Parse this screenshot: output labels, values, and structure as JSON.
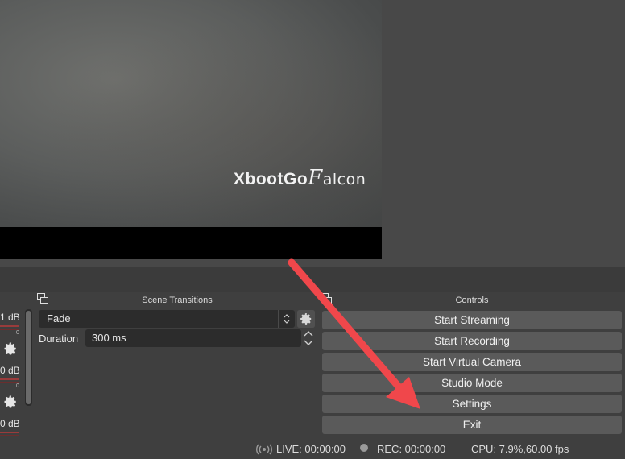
{
  "preview": {
    "watermark_part1": "Xboot",
    "watermark_part2": "Go",
    "watermark_part3": "F",
    "watermark_part4": "alcon"
  },
  "audio_mixer": {
    "channels": [
      {
        "db": "1 dB",
        "scale_zero": "0"
      },
      {
        "db": "0 dB",
        "scale_zero": "0"
      },
      {
        "db": "0 dB",
        "scale_zero": ""
      }
    ]
  },
  "scene_transitions": {
    "title": "Scene Transitions",
    "selected_transition": "Fade",
    "duration_label": "Duration",
    "duration_value": "300 ms"
  },
  "controls": {
    "title": "Controls",
    "buttons": [
      "Start Streaming",
      "Start Recording",
      "Start Virtual Camera",
      "Studio Mode",
      "Settings",
      "Exit"
    ]
  },
  "status_bar": {
    "live": "LIVE: 00:00:00",
    "rec": "REC: 00:00:00",
    "cpu": "CPU: 7.9%,60.00 fps"
  },
  "colors": {
    "annotation_arrow": "#f0474b",
    "button_bg": "#5a5a5a",
    "panel_bg": "#3f3f3f"
  }
}
